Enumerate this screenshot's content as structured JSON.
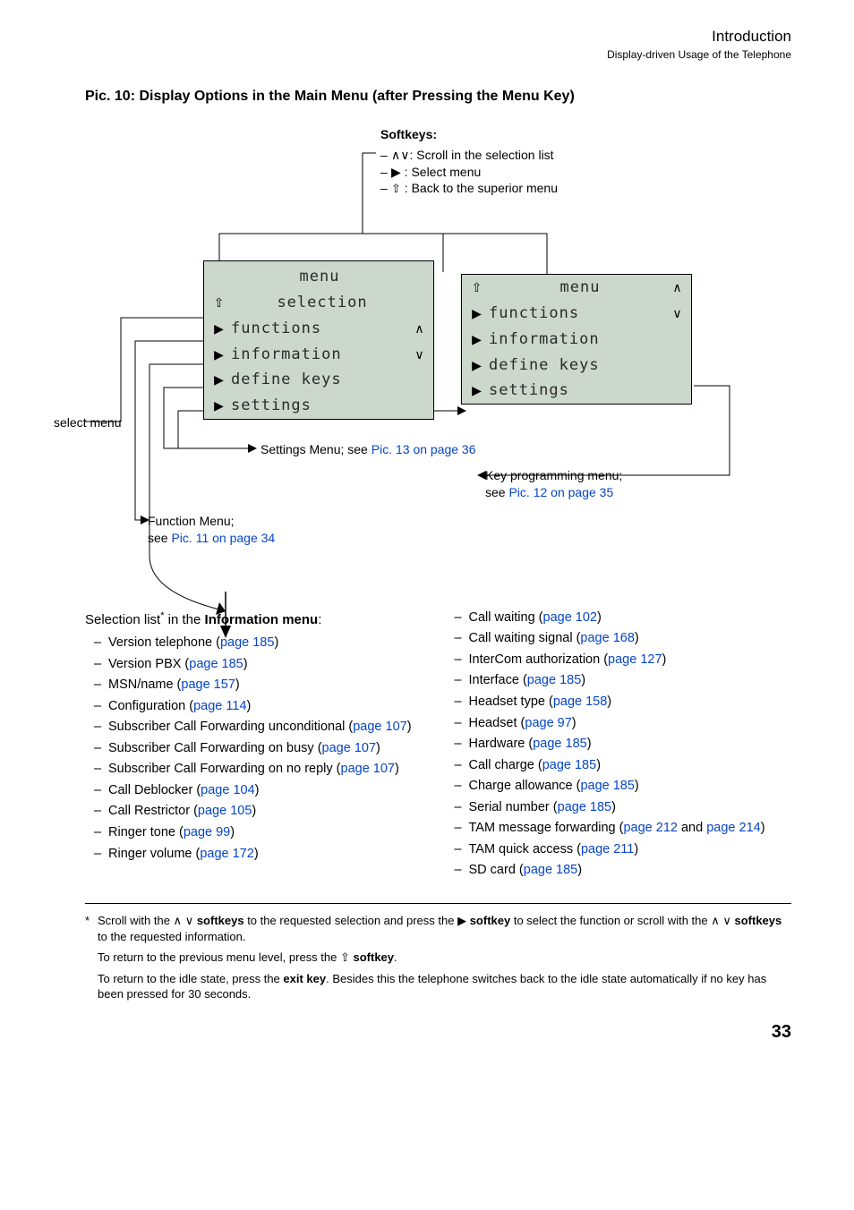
{
  "header": {
    "title": "Introduction",
    "subtitle": "Display-driven Usage of the Telephone"
  },
  "picTitle": "Pic. 10: Display Options in the Main Menu (after Pressing the Menu Key)",
  "softkeys": {
    "title": "Softkeys:",
    "scroll": ": Scroll in the selection list",
    "select": " : Select menu",
    "back": " : Back to the superior menu"
  },
  "selectMenuLabel": "select menu",
  "phoneLeft": {
    "header": "menu",
    "sub": "selection",
    "rows": [
      "functions",
      "information",
      "define keys",
      "settings"
    ]
  },
  "phoneRight": {
    "header": "menu",
    "rows": [
      "functions",
      "information",
      "define keys",
      "settings"
    ]
  },
  "notes": {
    "settingsPrefix": "Settings Menu; see ",
    "settingsLink": "Pic. 13 on page 36",
    "keyprogLine1": "Key programming menu;",
    "keyprogLine2a": "see ",
    "keyprogLine2b": "Pic. 12 on page 35",
    "funcLine1": "Function Menu;",
    "funcLine2a": "see ",
    "funcLine2b": "Pic. 11 on page 34"
  },
  "infoIntroA": "Selection list",
  "infoIntroStar": "*",
  "infoIntroB": " in the ",
  "infoIntroBold": "Information menu",
  "infoIntroC": ":",
  "leftItems": [
    {
      "t": "Version telephone (",
      "p": "page 185",
      "s": ")"
    },
    {
      "t": "Version PBX (",
      "p": "page 185",
      "s": ")"
    },
    {
      "t": "MSN/name (",
      "p": "page 157",
      "s": ")"
    },
    {
      "t": "Configuration (",
      "p": "page 114",
      "s": ")"
    },
    {
      "t": "Subscriber Call Forwarding unconditional (",
      "p": "page 107",
      "s": ")"
    },
    {
      "t": "Subscriber Call Forwarding on busy (",
      "p": "page 107",
      "s": ")"
    },
    {
      "t": "Subscriber Call Forwarding on no reply (",
      "p": "page 107",
      "s": ")"
    },
    {
      "t": "Call Deblocker (",
      "p": "page 104",
      "s": ")"
    },
    {
      "t": "Call Restrictor (",
      "p": "page 105",
      "s": ")"
    },
    {
      "t": "Ringer tone (",
      "p": "page 99",
      "s": ")"
    },
    {
      "t": "Ringer volume (",
      "p": "page 172",
      "s": ")"
    }
  ],
  "rightItems": [
    {
      "t": "Call waiting (",
      "p": "page 102",
      "s": ")"
    },
    {
      "t": "Call waiting signal (",
      "p": "page 168",
      "s": ")"
    },
    {
      "t": "InterCom authorization (",
      "p": "page 127",
      "s": ")"
    },
    {
      "t": "Interface (",
      "p": "page 185",
      "s": ")"
    },
    {
      "t": "Headset type (",
      "p": "page 158",
      "s": ")"
    },
    {
      "t": "Headset (",
      "p": "page 97",
      "s": ")"
    },
    {
      "t": "Hardware (",
      "p": "page 185",
      "s": ")"
    },
    {
      "t": "Call charge (",
      "p": "page 185",
      "s": ")"
    },
    {
      "t": "Charge allowance (",
      "p": "page 185",
      "s": ")"
    },
    {
      "t": "Serial number (",
      "p": "page 185",
      "s": ")"
    },
    {
      "t": "TAM message forwarding (",
      "p": "page 212",
      "mid": " and ",
      "p2": "page 214",
      "s": ")"
    },
    {
      "t": "TAM quick access (",
      "p": "page 211",
      "s": ")"
    },
    {
      "t": "SD card (",
      "p": "page 185",
      "s": ")"
    }
  ],
  "footnotes": {
    "l1a": "Scroll with the ",
    "l1b": " softkeys",
    "l1c": " to the requested selection and press the ",
    "l1d": " softkey",
    "l1e": " to select the function or scroll with the ",
    "l1f": " softkeys",
    "l1g": " to the requested information.",
    "l2a": "To return to the previous menu level, press the ",
    "l2b": " softkey",
    "l2c": ".",
    "l3a": "To return to the idle state, press the ",
    "l3b": "exit key",
    "l3c": ". Besides this the telephone switches back to the idle state automatically if no key has been pressed for 30 seconds."
  },
  "pageNumber": "33"
}
